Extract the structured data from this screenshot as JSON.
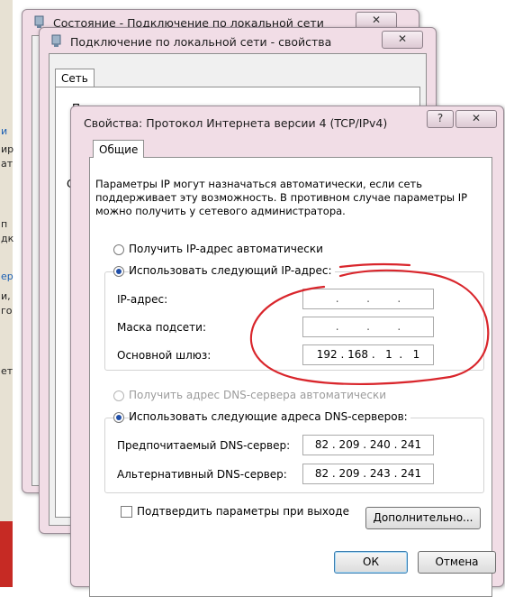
{
  "background": {
    "fragments": [
      "и",
      "ир",
      "ат",
      "п",
      "дк",
      "ер",
      "и,",
      "го",
      "ет"
    ]
  },
  "window_status": {
    "title": "Состояние - Подключение по локальной сети",
    "close_label": "✕"
  },
  "window_props": {
    "title": "Подключение по локальной сети - свойства",
    "close_label": "✕",
    "tab": "Сеть",
    "frags": [
      "П",
      "С"
    ]
  },
  "window_ipv4": {
    "title": "Свойства: Протокол Интернета версии 4 (TCP/IPv4)",
    "help_label": "?",
    "close_label": "✕",
    "tab": "Общие",
    "description": "Параметры IP могут назначаться автоматически, если сеть поддерживает эту возможность. В противном случае параметры IP можно получить у сетевого администратора.",
    "ip_auto_label": "Получить IP-адрес автоматически",
    "ip_manual_label": "Использовать следующий IP-адрес:",
    "ip_fields": [
      {
        "label": "IP-адрес:",
        "value": ".        .        ."
      },
      {
        "label": "Маска подсети:",
        "value": ".        .        ."
      },
      {
        "label": "Основной шлюз:",
        "value": "192 . 168 .   1  .   1"
      }
    ],
    "dns_auto_label": "Получить адрес DNS-сервера автоматически",
    "dns_manual_label": "Использовать следующие адреса DNS-серверов:",
    "dns_fields": [
      {
        "label": "Предпочитаемый DNS-сервер:",
        "value": "82 . 209 . 240 . 241"
      },
      {
        "label": "Альтернативный DNS-сервер:",
        "value": "82 . 209 . 243 . 241"
      }
    ],
    "validate_label": "Подтвердить параметры при выходе",
    "advanced_label": "Дополнительно...",
    "ok_label": "ОК",
    "cancel_label": "Отмена"
  },
  "colors": {
    "annotation": "#d9262c",
    "radio_dot": "#1f4ea8",
    "window_frame": "#f1dde6"
  }
}
